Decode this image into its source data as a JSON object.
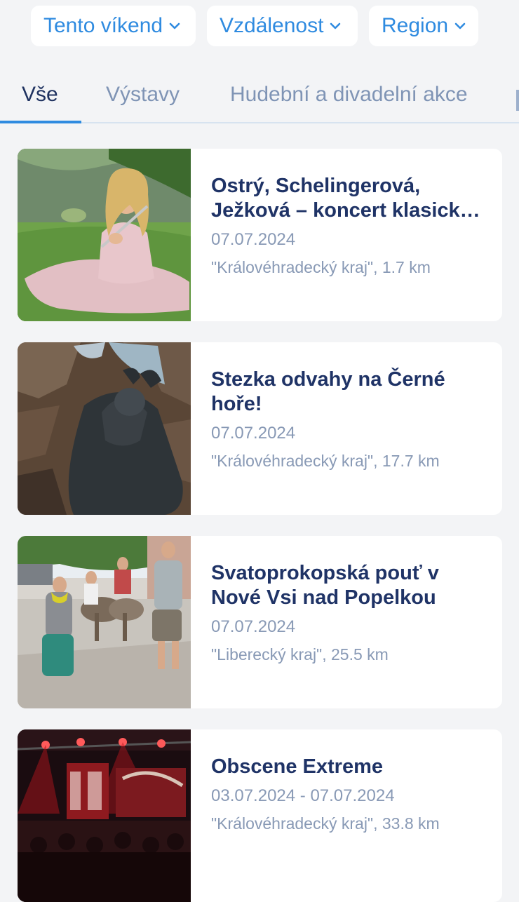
{
  "filters": [
    {
      "label": "Tento víkend"
    },
    {
      "label": "Vzdálenost"
    },
    {
      "label": "Region"
    }
  ],
  "tabs": [
    {
      "label": "Vše",
      "active": true
    },
    {
      "label": "Výstavy",
      "active": false
    },
    {
      "label": "Hudební a divadelní akce",
      "active": false
    }
  ],
  "events": [
    {
      "title": "Ostrý, Schelingerová, Ježková – koncert klasické hudby",
      "date": "07.07.2024",
      "location": "\"Královéhradecký kraj\", 1.7 km",
      "image_icon": "flutist-photo"
    },
    {
      "title": "Stezka odvahy na Černé hoře!",
      "date": "07.07.2024",
      "location": "\"Královéhradecký kraj\", 17.7 km",
      "image_icon": "costumed-figure-photo"
    },
    {
      "title": "Svatoprokopská pouť v Nové Vsi nad Popelkou",
      "date": "07.07.2024",
      "location": "\"Liberecký kraj\", 25.5 km",
      "image_icon": "donkey-procession-photo"
    },
    {
      "title": "Obscene Extreme",
      "date": "03.07.2024 - 07.07.2024",
      "location": "\"Královéhradecký kraj\", 33.8 km",
      "image_icon": "concert-stage-photo"
    }
  ],
  "colors": {
    "accent": "#2f8be0",
    "title": "#1f3366",
    "muted": "#8899b5",
    "background": "#f3f4f6"
  }
}
